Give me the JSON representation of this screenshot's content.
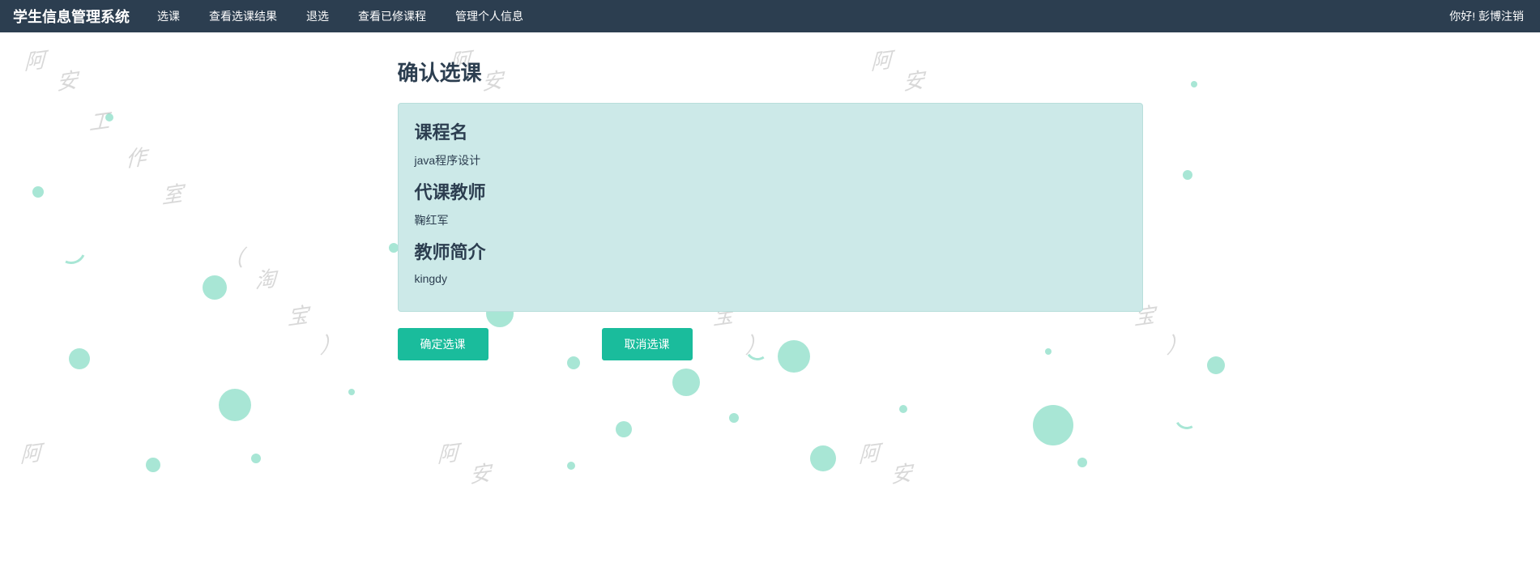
{
  "navbar": {
    "brand": "学生信息管理系统",
    "items": [
      "选课",
      "查看选课结果",
      "退选",
      "查看已修课程",
      "管理个人信息"
    ],
    "greeting": "你好! 彭博",
    "logout": "注销"
  },
  "page": {
    "title": "确认选课",
    "course_label": "课程名",
    "course_name": "java程序设计",
    "teacher_label": "代课教师",
    "teacher_name": "鞠红军",
    "intro_label": "教师简介",
    "intro_text": "kingdy",
    "confirm_btn": "确定选课",
    "cancel_btn": "取消选课"
  },
  "watermark": {
    "text": "阿安工作室（淘宝）"
  }
}
